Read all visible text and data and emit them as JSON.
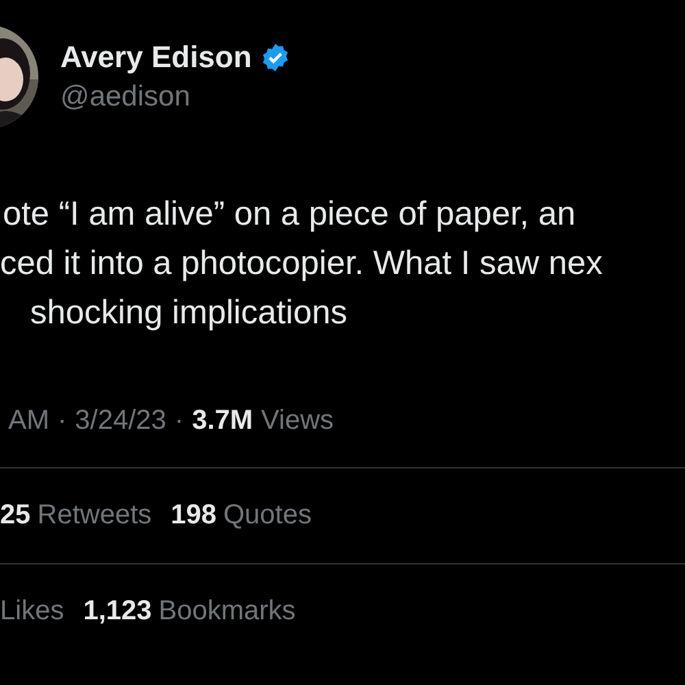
{
  "author": {
    "name": "Avery Edison",
    "verified": true,
    "handle": "@aedison"
  },
  "body_lines": [
    "ote “I am alive” on a piece of paper, an",
    "ced it into a photocopier. What I saw nex",
    "shocking implications"
  ],
  "meta": {
    "time": "AM",
    "separators": [
      "·",
      "·"
    ],
    "date": "3/24/23",
    "views_count": "3.7M",
    "views_label": "Views"
  },
  "stat_rows": [
    {
      "stats": [
        {
          "count": "25",
          "label": "Retweets"
        },
        {
          "count": "198",
          "label": "Quotes"
        }
      ]
    },
    {
      "stats": [
        {
          "label": "Likes"
        },
        {
          "count": "1,123",
          "label": "Bookmarks"
        }
      ]
    }
  ]
}
